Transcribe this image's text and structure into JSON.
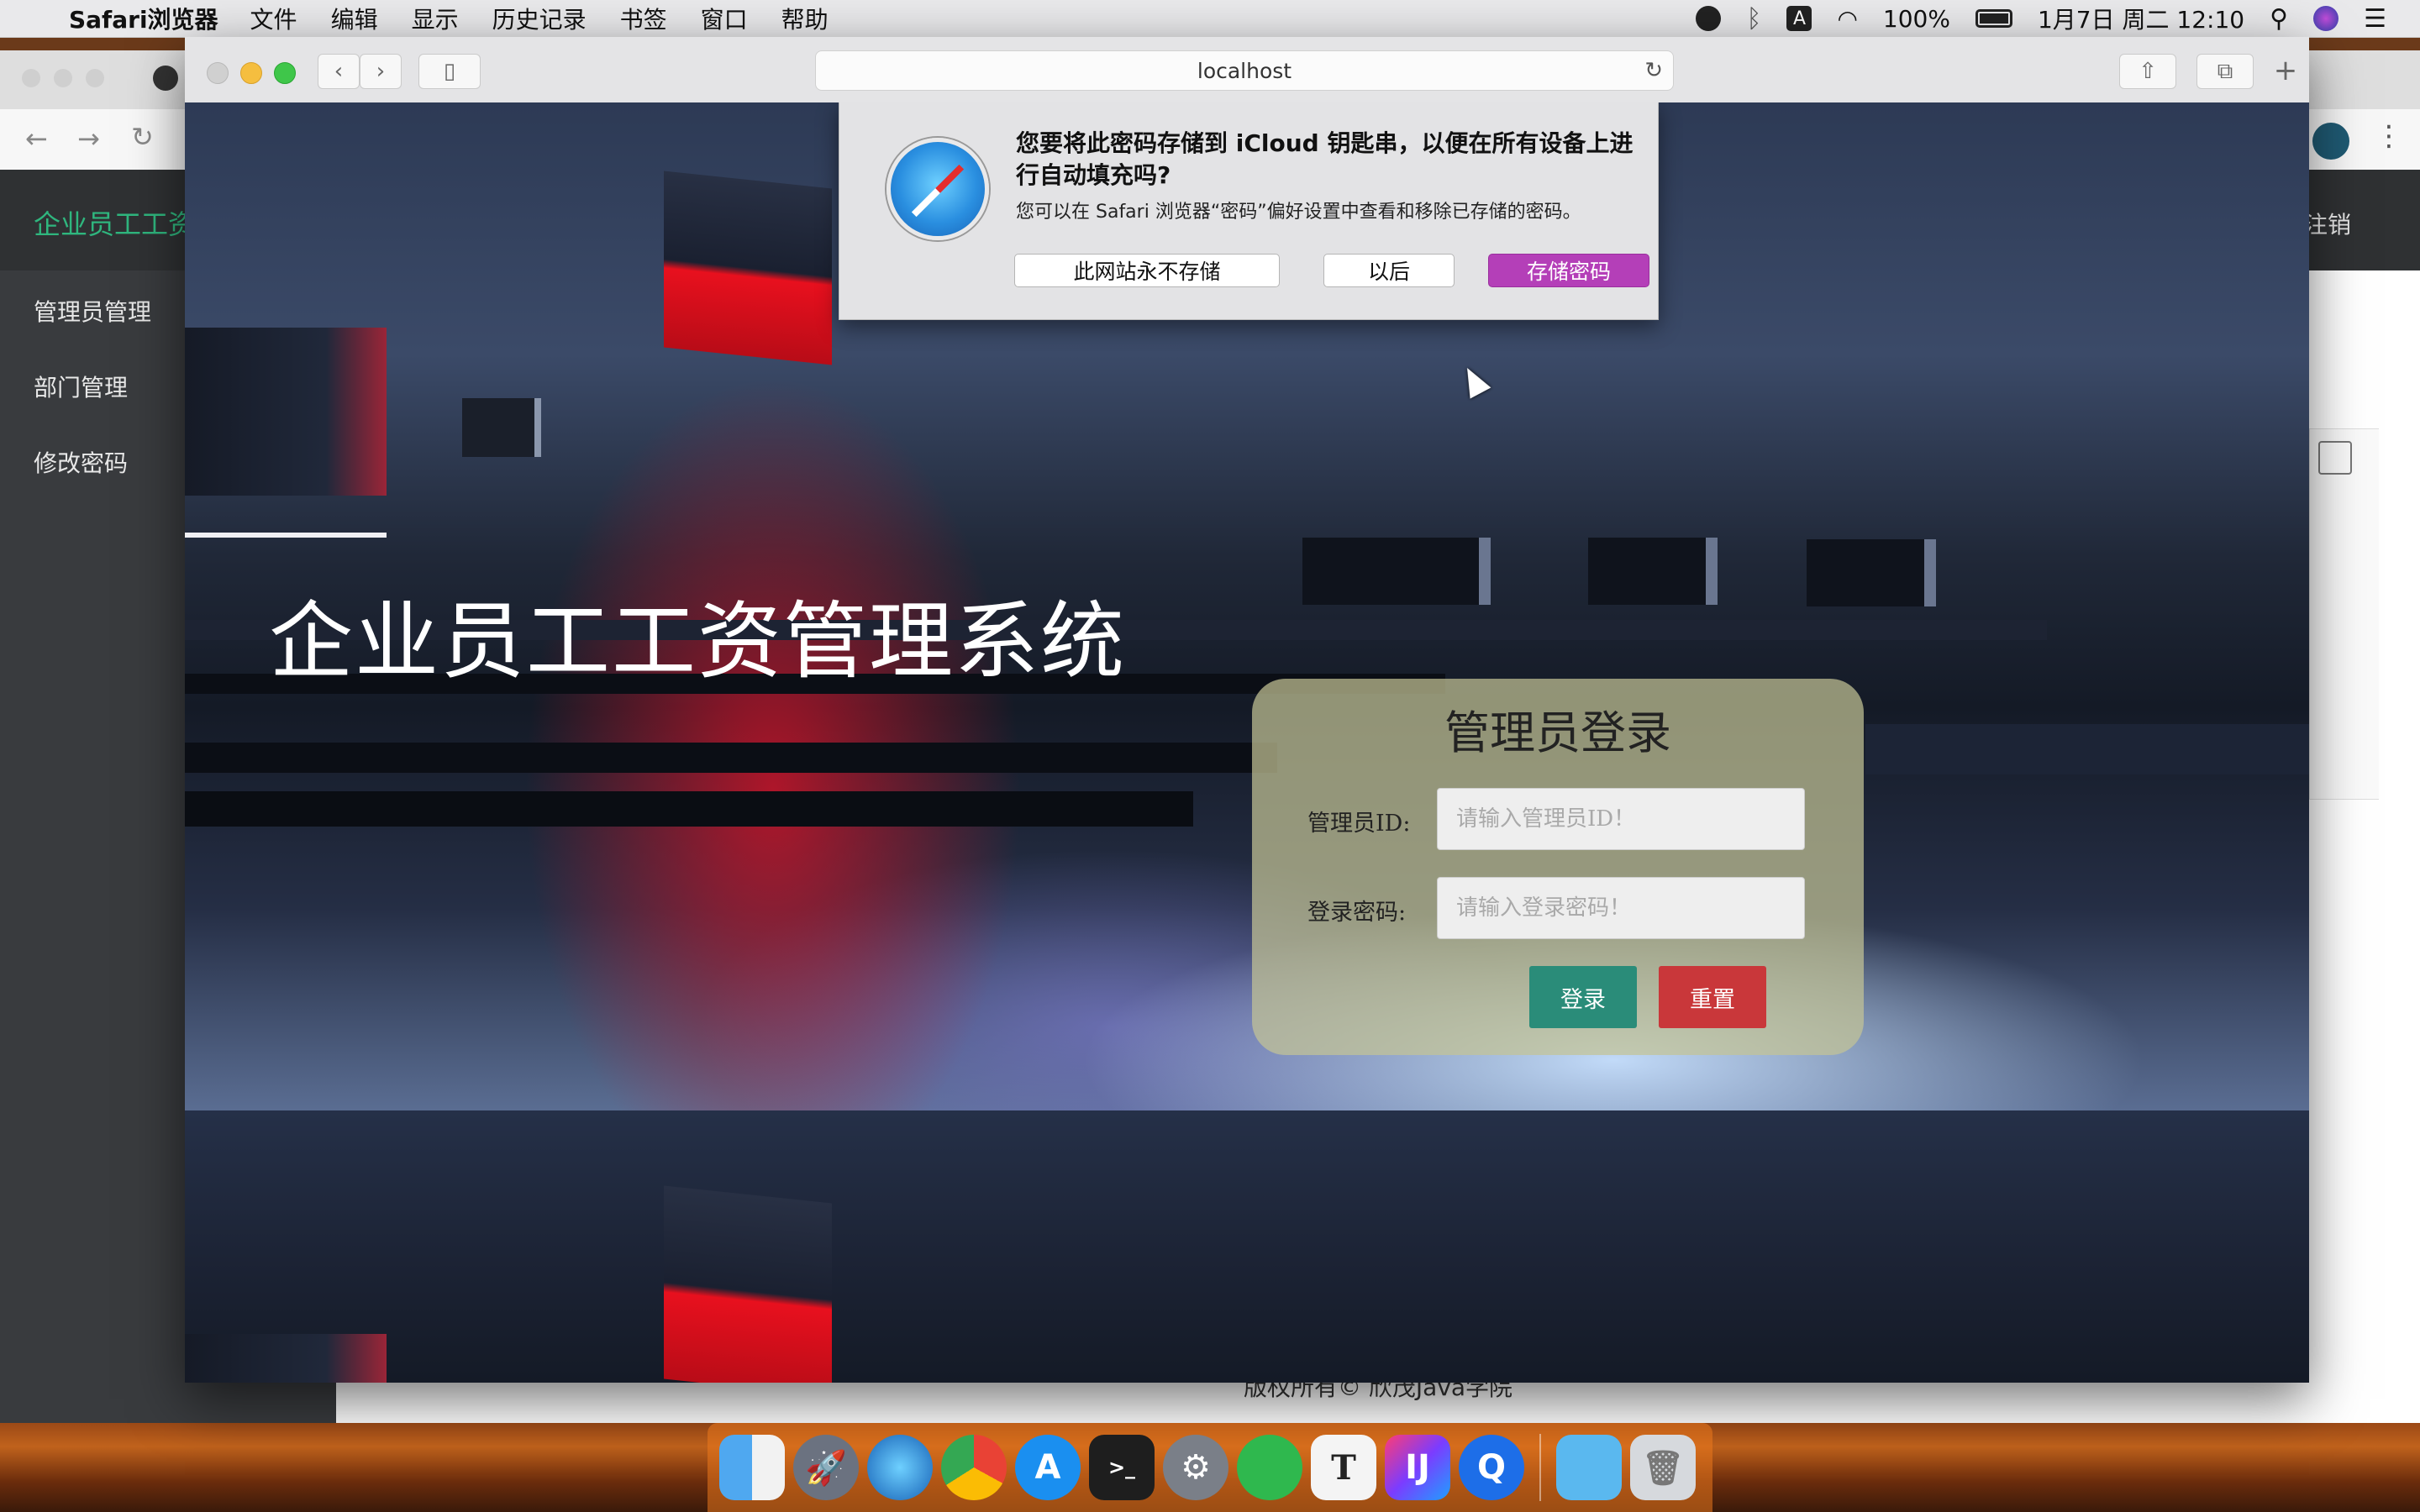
{
  "menubar": {
    "app_name": "Safari浏览器",
    "items": [
      "文件",
      "编辑",
      "显示",
      "历史记录",
      "书签",
      "窗口",
      "帮助"
    ],
    "input_badge": "A",
    "battery": "100%",
    "clock": "1月7日 周二 12:10"
  },
  "background_app": {
    "brand": "企业员工工资",
    "sidebar": [
      "管理员管理",
      "部门管理",
      "修改密码"
    ],
    "logout": "注销",
    "footer": "版权所有© 欣茂Java学院"
  },
  "safari": {
    "url": "localhost",
    "reload_glyph": "↻"
  },
  "password_prompt": {
    "title": "您要将此密码存储到 iCloud 钥匙串，以便在所有设备上进行自动填充吗?",
    "body": "您可以在 Safari 浏览器“密码”偏好设置中查看和移除已存储的密码。",
    "never_label": "此网站永不存储",
    "later_label": "以后",
    "save_label": "存储密码"
  },
  "page": {
    "title": "企业员工工资管理系统",
    "login": {
      "heading": "管理员登录",
      "id_label": "管理员ID:",
      "id_placeholder": "请输入管理员ID！",
      "password_label": "登录密码:",
      "password_placeholder": "请输入登录密码！",
      "submit_label": "登录",
      "reset_label": "重置"
    }
  },
  "colors": {
    "login_button": "#2a8c79",
    "reset_button": "#c9373a",
    "save_button": "#b43fb8",
    "brand_green": "#2fb67e"
  },
  "dock": [
    "finder-icon",
    "launchpad-icon",
    "safari-icon",
    "chrome-icon",
    "app-store-icon",
    "terminal-icon",
    "system-preferences-icon",
    "navicat-icon",
    "typora-icon",
    "intellij-icon",
    "quicktime-icon",
    "folder-icon",
    "trash-icon"
  ]
}
